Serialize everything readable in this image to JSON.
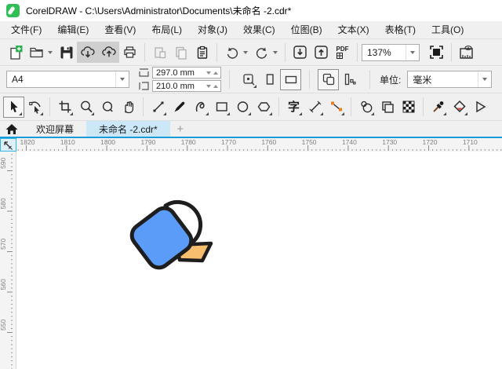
{
  "window": {
    "title": "CorelDRAW - C:\\Users\\Administrator\\Documents\\未命名 -2.cdr*"
  },
  "menus": [
    "文件(F)",
    "编辑(E)",
    "查看(V)",
    "布局(L)",
    "对象(J)",
    "效果(C)",
    "位图(B)",
    "文本(X)",
    "表格(T)",
    "工具(O)"
  ],
  "toolbar": {
    "zoom_level": "137%",
    "pdf_label": "PDF"
  },
  "property_bar": {
    "page_size": "A4",
    "page_width": "297.0 mm",
    "page_height": "210.0 mm",
    "units_label": "单位:",
    "units_value": "毫米"
  },
  "toolbox": {
    "text_tool_label": "字"
  },
  "tabs": {
    "welcome": "欢迎屏幕",
    "document": "未命名 -2.cdr*",
    "new_tab": "+"
  },
  "rulers": {
    "horizontal": {
      "labels": [
        "1820",
        "1810",
        "1800",
        "1790",
        "1780",
        "1770",
        "1760",
        "1750",
        "1740",
        "1730",
        "1720",
        "1710"
      ],
      "start": 12,
      "spacing": 51.3
    },
    "vertical": {
      "labels": [
        "590",
        "580",
        "570",
        "560",
        "550"
      ],
      "start": 24,
      "spacing": 51.5
    }
  },
  "canvas_shape": {
    "body_color": "#5B9CF8",
    "dome_color": "#ffffff",
    "stick_color": "#F7BE6E",
    "outline_color": "#1E1E1E"
  },
  "colors": {
    "accent_blue": "#1a9cd8",
    "active_tab": "#cbe7f8",
    "pressed_gray": "#cfcfcf",
    "connector_orange": "#e8821e"
  }
}
